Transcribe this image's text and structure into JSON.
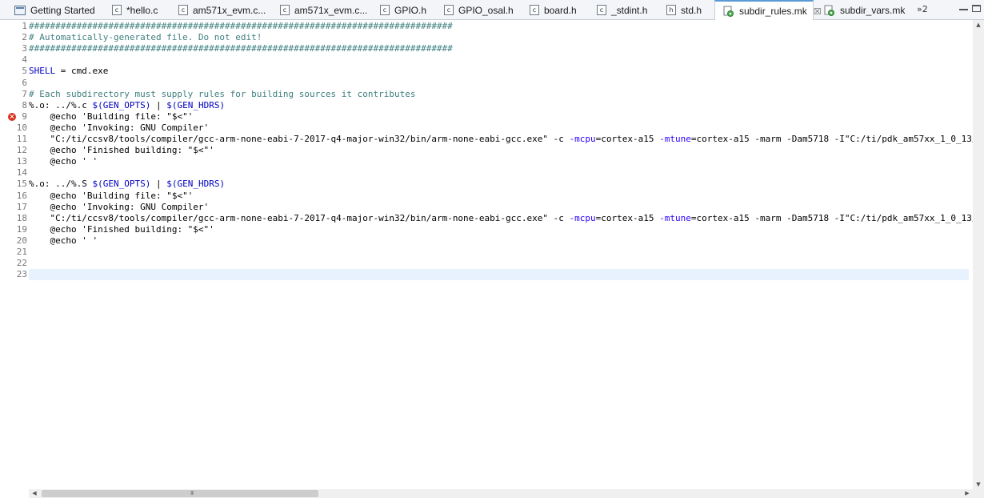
{
  "tabs": [
    {
      "label": "Getting Started",
      "icon": "page-icon"
    },
    {
      "label": "*hello.c",
      "icon": "c-file-icon",
      "glyph": "c"
    },
    {
      "label": "am571x_evm.c...",
      "icon": "c-file-icon",
      "glyph": "c"
    },
    {
      "label": "am571x_evm.c...",
      "icon": "c-file-icon",
      "glyph": "c"
    },
    {
      "label": "GPIO.h",
      "icon": "h-file-icon",
      "glyph": "c"
    },
    {
      "label": "GPIO_osal.h",
      "icon": "h-file-icon",
      "glyph": "c"
    },
    {
      "label": "board.h",
      "icon": "h-file-icon",
      "glyph": "c"
    },
    {
      "label": "_stdint.h",
      "icon": "h-file-icon",
      "glyph": "c"
    },
    {
      "label": "std.h",
      "icon": "h-file-icon",
      "glyph": "h"
    },
    {
      "label": "subdir_rules.mk",
      "icon": "makefile-icon",
      "active": true,
      "close": "☒"
    },
    {
      "label": "subdir_vars.mk",
      "icon": "makefile-icon"
    }
  ],
  "overflow_label": "»2",
  "editor": {
    "error_marker_line": 9,
    "current_line": 23,
    "lines": [
      {
        "n": "1",
        "text": "################################################################################",
        "style": "cmt"
      },
      {
        "n": "2",
        "text": "# Automatically-generated file. Do not edit!",
        "style": "cmt"
      },
      {
        "n": "3",
        "text": "################################################################################",
        "style": "cmt"
      },
      {
        "n": "4",
        "text": ""
      },
      {
        "n": "5",
        "parts": [
          [
            "var",
            "SHELL"
          ],
          [
            "",
            " = cmd.exe"
          ]
        ]
      },
      {
        "n": "6",
        "text": ""
      },
      {
        "n": "7",
        "text": "# Each subdirectory must supply rules for building sources it contributes",
        "style": "cmt"
      },
      {
        "n": "8",
        "parts": [
          [
            "",
            "%.o: ../%.c "
          ],
          [
            "var",
            "$(GEN_OPTS)"
          ],
          [
            "",
            " | "
          ],
          [
            "var",
            "$(GEN_HDRS)"
          ]
        ]
      },
      {
        "n": "9",
        "text": "\t@echo 'Building file: \"$<\"'"
      },
      {
        "n": "10",
        "text": "\t@echo 'Invoking: GNU Compiler'"
      },
      {
        "n": "11",
        "parts": [
          [
            "",
            "\t\"C:/ti/ccsv8/tools/compiler/gcc-arm-none-eabi-7-2017-q4-major-win32/bin/arm-none-eabi-gcc.exe\" -c "
          ],
          [
            "kw",
            "-mcpu"
          ],
          [
            "",
            "=cortex-a15 "
          ],
          [
            "kw",
            "-mtune"
          ],
          [
            "",
            "=cortex-a15 -marm -Dam5718 -I\"C:/ti/pdk_am57xx_1_0_13/"
          ]
        ]
      },
      {
        "n": "12",
        "text": "\t@echo 'Finished building: \"$<\"'"
      },
      {
        "n": "13",
        "text": "\t@echo ' '"
      },
      {
        "n": "14",
        "text": ""
      },
      {
        "n": "15",
        "parts": [
          [
            "",
            "%.o: ../%.S "
          ],
          [
            "var",
            "$(GEN_OPTS)"
          ],
          [
            "",
            " | "
          ],
          [
            "var",
            "$(GEN_HDRS)"
          ]
        ]
      },
      {
        "n": "16",
        "text": "\t@echo 'Building file: \"$<\"'"
      },
      {
        "n": "17",
        "text": "\t@echo 'Invoking: GNU Compiler'"
      },
      {
        "n": "18",
        "parts": [
          [
            "",
            "\t\"C:/ti/ccsv8/tools/compiler/gcc-arm-none-eabi-7-2017-q4-major-win32/bin/arm-none-eabi-gcc.exe\" -c "
          ],
          [
            "kw",
            "-mcpu"
          ],
          [
            "",
            "=cortex-a15 "
          ],
          [
            "kw",
            "-mtune"
          ],
          [
            "",
            "=cortex-a15 -marm -Dam5718 -I\"C:/ti/pdk_am57xx_1_0_13/"
          ]
        ]
      },
      {
        "n": "19",
        "text": "\t@echo 'Finished building: \"$<\"'"
      },
      {
        "n": "20",
        "text": "\t@echo ' '"
      },
      {
        "n": "21",
        "text": ""
      },
      {
        "n": "22",
        "text": ""
      },
      {
        "n": "23",
        "text": ""
      }
    ]
  },
  "hscroll": {
    "grip": "III"
  },
  "colors": {
    "comment": "#3f7f7f",
    "variable": "#0000c0",
    "option": "#2a00ff",
    "current_line": "#e8f2fe",
    "error": "#d9331f"
  }
}
